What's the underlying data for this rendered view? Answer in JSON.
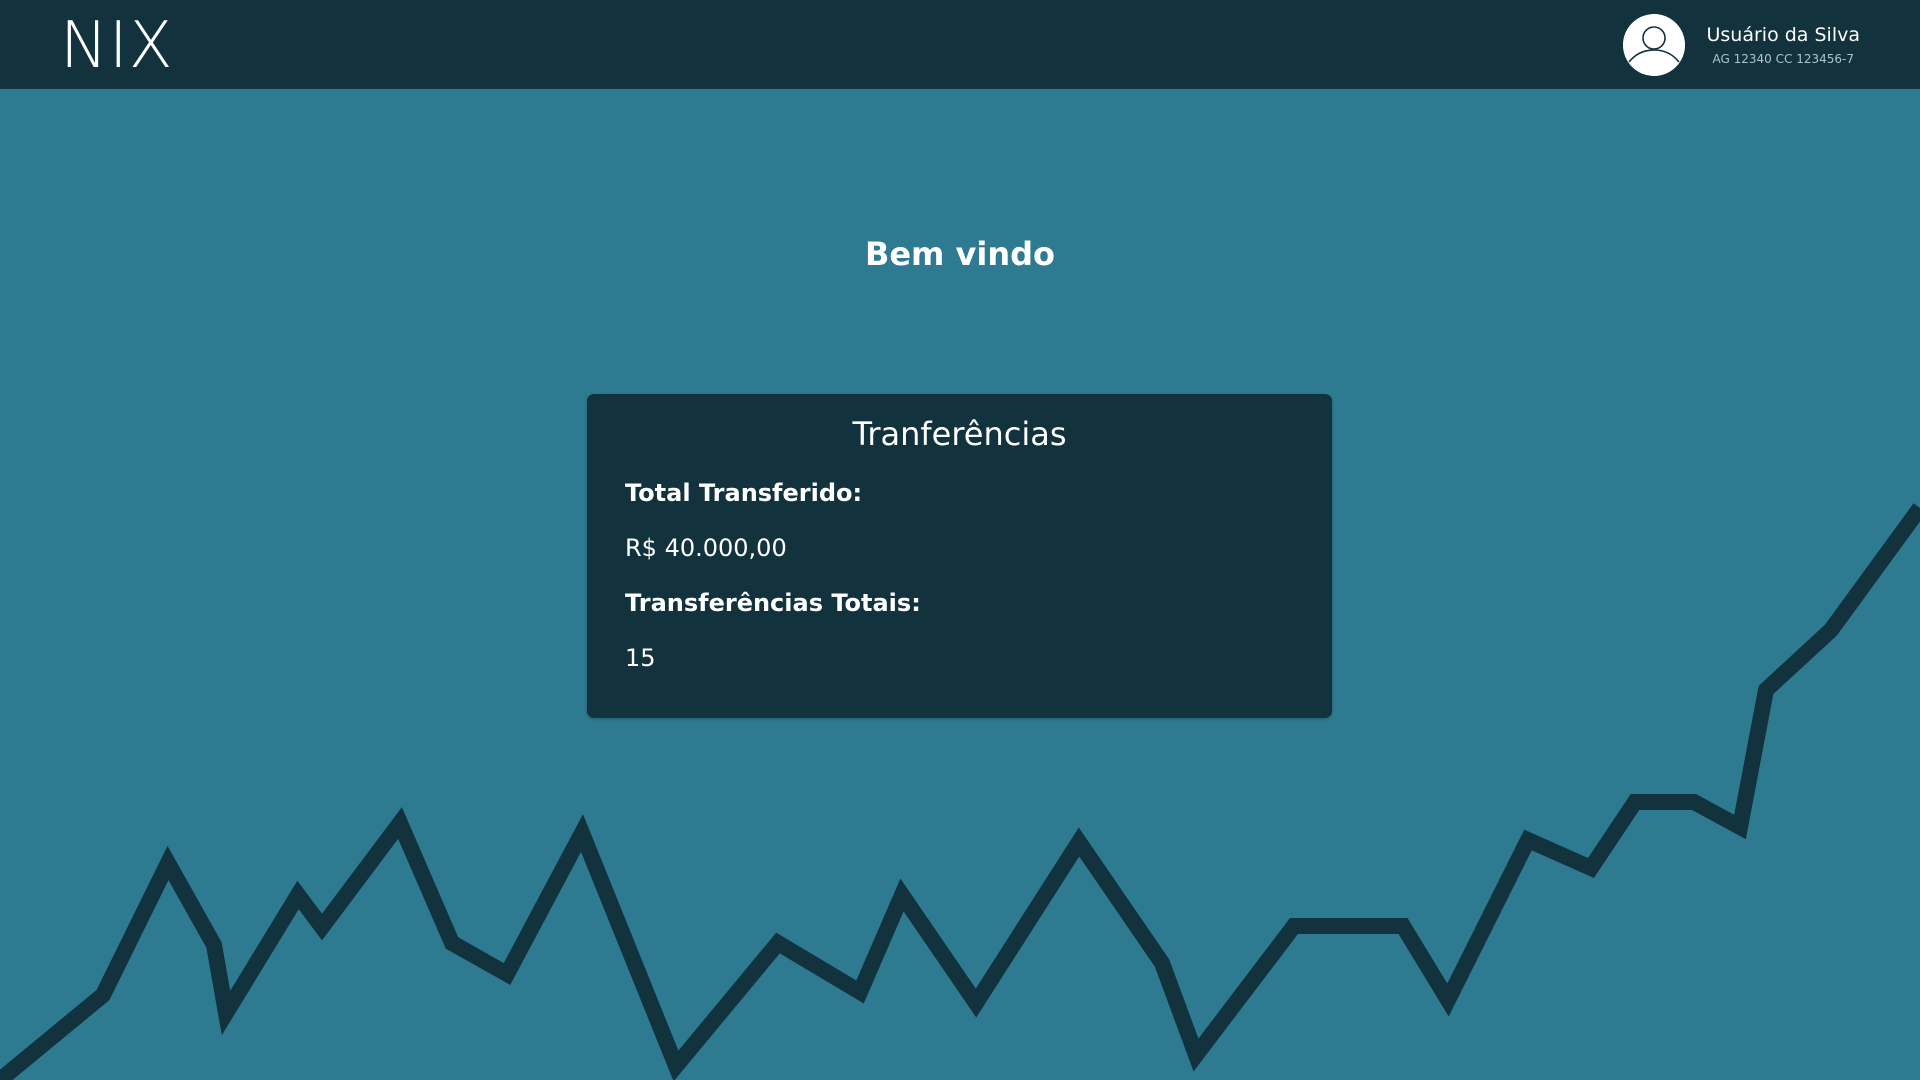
{
  "header": {
    "logo": "NIX",
    "user": {
      "name": "Usuário da Silva",
      "account": "AG 12340 CC 123456-7",
      "avatar_icon": "user-avatar-icon"
    }
  },
  "main": {
    "welcome": "Bem vindo",
    "card": {
      "title": "Tranferências",
      "total_label": "Total Transferido:",
      "total_value": "R$ 40.000,00",
      "count_label": "Transferências Totais:",
      "count_value": "15"
    }
  },
  "colors": {
    "background": "#2e7b91",
    "header": "#12323d",
    "card": "#12323d",
    "line": "#12323d",
    "text": "#ffffff"
  }
}
